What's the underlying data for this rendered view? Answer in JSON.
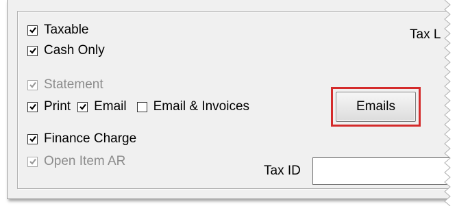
{
  "checkboxes": {
    "taxable": {
      "label": "Taxable",
      "checked": true,
      "disabled": false
    },
    "cash_only": {
      "label": "Cash Only",
      "checked": true,
      "disabled": false
    },
    "statement": {
      "label": "Statement",
      "checked": true,
      "disabled": true
    },
    "print": {
      "label": "Print",
      "checked": true,
      "disabled": false
    },
    "email": {
      "label": "Email",
      "checked": true,
      "disabled": false
    },
    "email_invoices": {
      "label": "Email & Invoices",
      "checked": false,
      "disabled": false
    },
    "finance_charge": {
      "label": "Finance Charge",
      "checked": true,
      "disabled": false
    },
    "open_item_ar": {
      "label": "Open Item AR",
      "checked": true,
      "disabled": true
    }
  },
  "buttons": {
    "emails_label": "Emails"
  },
  "labels": {
    "tax_l": "Tax L",
    "tax_id": "Tax ID"
  },
  "fields": {
    "tax_id_value": ""
  },
  "colors": {
    "highlight": "#d42b2b",
    "panel_bg": "#f0f0f0",
    "disabled_text": "#8c8c8c"
  }
}
